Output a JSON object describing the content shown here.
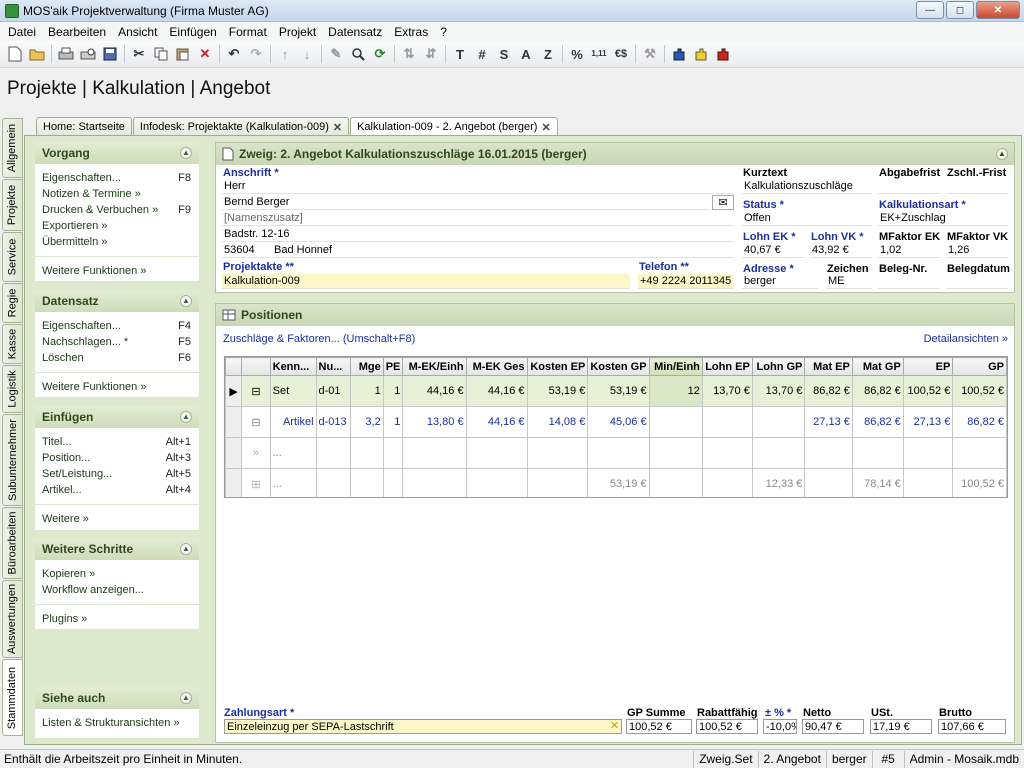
{
  "window": {
    "title": "MOS'aik Projektverwaltung (Firma Muster AG)",
    "min": "—",
    "max": "◻",
    "close": "✕"
  },
  "menu": [
    "Datei",
    "Bearbeiten",
    "Ansicht",
    "Einfügen",
    "Format",
    "Projekt",
    "Datensatz",
    "Extras",
    "?"
  ],
  "toolbar": {
    "t1": "T",
    "t2": "#",
    "t3": "S",
    "t4": "A",
    "t5": "Z",
    "pct": "%",
    "num": "1,11",
    "euro": "€$"
  },
  "page_title": "Projekte | Kalkulation | Angebot",
  "side_tabs": [
    "Allgemein",
    "Projekte",
    "Service",
    "Regie",
    "Kasse",
    "Logistik",
    "Subunternehmer",
    "Büroarbeiten",
    "Auswertungen",
    "Stammdaten"
  ],
  "doc_tabs": [
    "Home: Startseite",
    "Infodesk: Projektakte (Kalkulation-009)",
    "Kalkulation-009 - 2. Angebot (berger)"
  ],
  "vorgang": {
    "title": "Vorgang",
    "items": [
      {
        "label": "Eigenschaften...",
        "key": "F8"
      },
      {
        "label": "Notizen & Termine »",
        "key": ""
      },
      {
        "label": "Drucken & Verbuchen »",
        "key": "F9"
      },
      {
        "label": "Exportieren »",
        "key": ""
      },
      {
        "label": "Übermitteln »",
        "key": ""
      }
    ],
    "more": "Weitere Funktionen »"
  },
  "datensatz": {
    "title": "Datensatz",
    "items": [
      {
        "label": "Eigenschaften...",
        "key": "F4"
      },
      {
        "label": "Nachschlagen... *",
        "key": "F5"
      },
      {
        "label": "Löschen",
        "key": "F6"
      }
    ],
    "more": "Weitere Funktionen »"
  },
  "einfuegen": {
    "title": "Einfügen",
    "items": [
      {
        "label": "Titel...",
        "key": "Alt+1"
      },
      {
        "label": "Position...",
        "key": "Alt+3"
      },
      {
        "label": "Set/Leistung...",
        "key": "Alt+5"
      },
      {
        "label": "Artikel...",
        "key": "Alt+4"
      }
    ],
    "more": "Weitere »"
  },
  "weitere": {
    "title": "Weitere Schritte",
    "items": [
      "Kopieren »",
      "Workflow anzeigen..."
    ],
    "more": "Plugins »"
  },
  "siehe": {
    "title": "Siehe auch",
    "items": [
      "Listen & Strukturansichten »"
    ]
  },
  "header": {
    "title": "Zweig: 2. Angebot Kalkulationszuschläge 16.01.2015 (berger)",
    "anschrift_label": "Anschrift *",
    "address": [
      "Herr",
      "Bernd Berger",
      "[Namenszusatz]",
      "Badstr. 12-16"
    ],
    "zip": "53604",
    "city": "Bad Honnef",
    "projektakte_label": "Projektakte **",
    "projektakte": "Kalkulation-009",
    "telefon_label": "Telefon **",
    "telefon": "+49 2224 2011345",
    "kurztext_label": "Kurztext",
    "kurztext": "Kalkulationszuschläge",
    "abgabefrist_label": "Abgabefrist",
    "zschl_label": "Zschl.-Frist",
    "status_label": "Status *",
    "status": "Offen",
    "kalkart_label": "Kalkulationsart *",
    "kalkart": "EK+Zuschlag",
    "lohnek_label": "Lohn EK *",
    "lohnek": "40,67 €",
    "lohnvk_label": "Lohn VK *",
    "lohnvk": "43,92 €",
    "mfek_label": "MFaktor EK",
    "mfek": "1,02",
    "mfvk_label": "MFaktor VK",
    "mfvk": "1,26",
    "adresse_label": "Adresse *",
    "adresse": "berger",
    "zeichen_label": "Zeichen",
    "zeichen": "ME",
    "belegnr_label": "Beleg-Nr.",
    "belegdatum_label": "Belegdatum"
  },
  "positions": {
    "title": "Positionen",
    "zuschlaege_link": "Zuschläge & Faktoren... (Umschalt+F8)",
    "detail_link": "Detailansichten »",
    "columns": [
      "Kenn...",
      "Nu...",
      "Mge",
      "PE",
      "M-EK/Einh",
      "M-EK Ges",
      "Kosten EP",
      "Kosten GP",
      "Min/Einh",
      "Lohn EP",
      "Lohn GP",
      "Mat EP",
      "Mat GP",
      "EP",
      "GP"
    ],
    "rows": [
      [
        "Set",
        "d-01",
        "1",
        "1",
        "44,16 €",
        "44,16 €",
        "53,19 €",
        "53,19 €",
        "12",
        "13,70 €",
        "13,70 €",
        "86,82 €",
        "86,82 €",
        "100,52 €",
        "100,52 €"
      ],
      [
        "Artikel",
        "d-013",
        "3,2",
        "1",
        "13,80 €",
        "44,16 €",
        "14,08 €",
        "45,06 €",
        "",
        "",
        "",
        "27,13 €",
        "86,82 €",
        "27,13 €",
        "86,82 €"
      ],
      [
        "...",
        "",
        "",
        "",
        "",
        "",
        "",
        "",
        "",
        "",
        "",
        "",
        "",
        "",
        ""
      ],
      [
        "...",
        "",
        "",
        "",
        "",
        "",
        "",
        "53,19 €",
        "",
        "",
        "12,33 €",
        "",
        "78,14 €",
        "",
        "100,52 €"
      ]
    ]
  },
  "footer": {
    "zahlungsart_label": "Zahlungsart *",
    "zahlungsart": "Einzeleinzug per SEPA-Lastschrift",
    "labels": [
      "GP Summe",
      "Rabattfähig",
      "± % *",
      "Netto",
      "USt.",
      "Brutto"
    ],
    "values": [
      "100,52 €",
      "100,52 €",
      "-10,0%",
      "90,47 €",
      "17,19 €",
      "107,66 €"
    ]
  },
  "statusbar": {
    "message": "Enthält die Arbeitszeit pro Einheit in Minuten.",
    "cells": [
      "Zweig.Set",
      "2. Angebot",
      "berger",
      "#5",
      "Admin - Mosaik.mdb"
    ]
  }
}
